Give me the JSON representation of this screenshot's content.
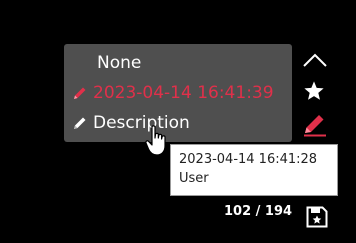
{
  "panel": {
    "title": "None",
    "date": "2023-04-14 16:41:39",
    "description": "Description"
  },
  "tooltip": {
    "timestamp": "2023-04-14 16:41:28",
    "author": "User"
  },
  "counter": "102 / 194",
  "colors": {
    "background": "#000000",
    "panel": "#4f4f4f",
    "accent": "#e0304a",
    "text": "#ffffff"
  },
  "icons": [
    "pencil-icon",
    "chevron-up-icon",
    "star-icon",
    "edit-icon",
    "save-bookmark-icon",
    "hand-cursor-icon"
  ]
}
